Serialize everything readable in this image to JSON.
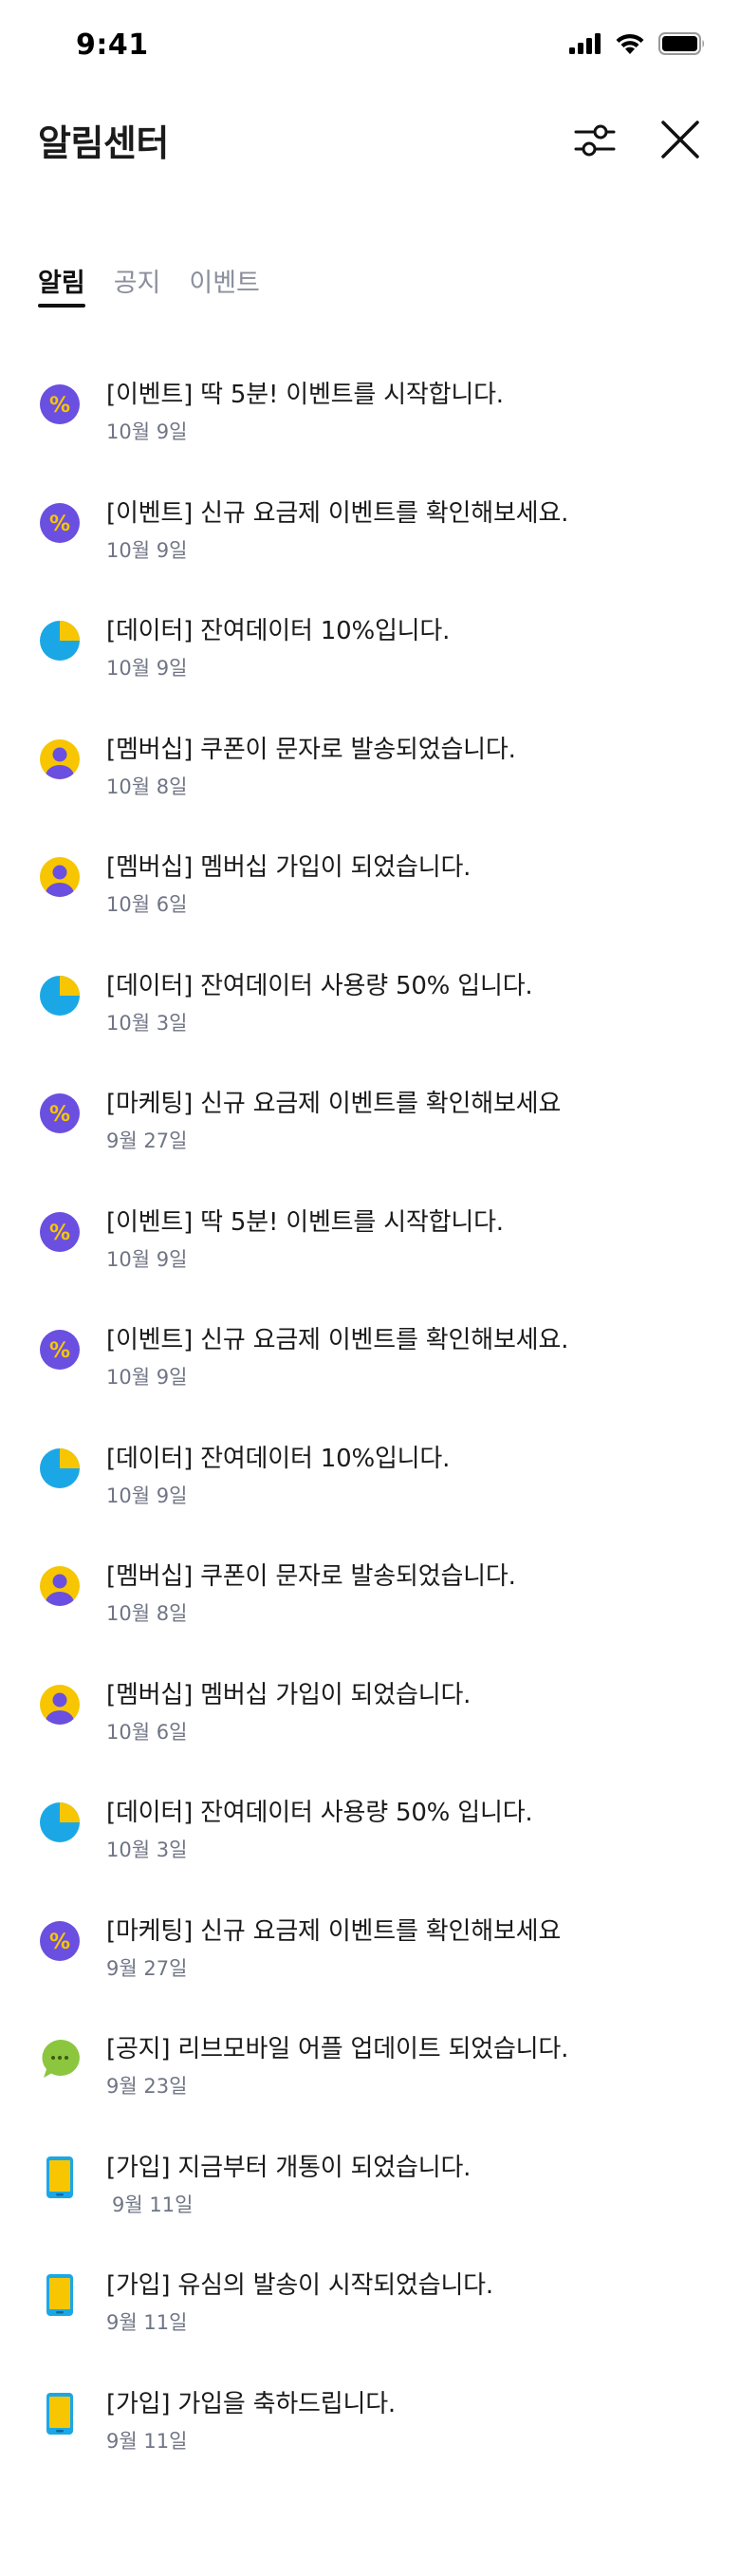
{
  "status": {
    "time": "9:41"
  },
  "header": {
    "title": "알림센터"
  },
  "tabs": [
    {
      "label": "알림",
      "active": true
    },
    {
      "label": "공지",
      "active": false
    },
    {
      "label": "이벤트",
      "active": false
    }
  ],
  "colors": {
    "purple": "#6a4fe0",
    "yellow": "#f7c600",
    "blue": "#1ba7e6",
    "green": "#8cc63f",
    "date_gray": "#6f7585",
    "tab_gray": "#8a8f9c"
  },
  "notifications": [
    {
      "icon": "percent-icon",
      "title": "[이벤트] 딱 5분! 이벤트를 시작합니다.",
      "date": "10월 9일"
    },
    {
      "icon": "percent-icon",
      "title": "[이벤트] 신규 요금제 이벤트를 확인해보세요.",
      "date": "10월 9일"
    },
    {
      "icon": "pie-chart-icon",
      "title": "[데이터] 잔여데이터 10%입니다.",
      "date": "10월 9일"
    },
    {
      "icon": "person-icon",
      "title": "[멤버십] 쿠폰이 문자로 발송되었습니다.",
      "date": "10월 8일"
    },
    {
      "icon": "person-icon",
      "title": "[멤버십] 멤버십 가입이 되었습니다.",
      "date": "10월 6일"
    },
    {
      "icon": "pie-chart-icon",
      "title": "[데이터] 잔여데이터 사용량 50% 입니다.",
      "date": "10월 3일"
    },
    {
      "icon": "percent-icon",
      "title": "[마케팅] 신규 요금제 이벤트를 확인해보세요",
      "date": "9월 27일"
    },
    {
      "icon": "percent-icon",
      "title": "[이벤트] 딱 5분! 이벤트를 시작합니다.",
      "date": "10월 9일"
    },
    {
      "icon": "percent-icon",
      "title": "[이벤트] 신규 요금제 이벤트를 확인해보세요.",
      "date": "10월 9일"
    },
    {
      "icon": "pie-chart-icon",
      "title": "[데이터] 잔여데이터 10%입니다.",
      "date": "10월 9일"
    },
    {
      "icon": "person-icon",
      "title": "[멤버십] 쿠폰이 문자로 발송되었습니다.",
      "date": "10월 8일"
    },
    {
      "icon": "person-icon",
      "title": "[멤버십] 멤버십 가입이 되었습니다.",
      "date": "10월 6일"
    },
    {
      "icon": "pie-chart-icon",
      "title": "[데이터] 잔여데이터 사용량 50% 입니다.",
      "date": "10월 3일"
    },
    {
      "icon": "percent-icon",
      "title": "[마케팅] 신규 요금제 이벤트를 확인해보세요",
      "date": "9월 27일"
    },
    {
      "icon": "chat-bubble-icon",
      "title": "[공지] 리브모바일 어플 업데이트 되었습니다.",
      "date": "9월 23일"
    },
    {
      "icon": "phone-icon",
      "title": "[가입] 지금부터 개통이 되었습니다.",
      "date": "9월 11일"
    },
    {
      "icon": "phone-icon",
      "title": "[가입] 유심의 발송이 시작되었습니다.",
      "date": "9월 11일"
    },
    {
      "icon": "phone-icon",
      "title": "[가입] 가입을 축하드립니다.",
      "date": "9월 11일"
    }
  ]
}
